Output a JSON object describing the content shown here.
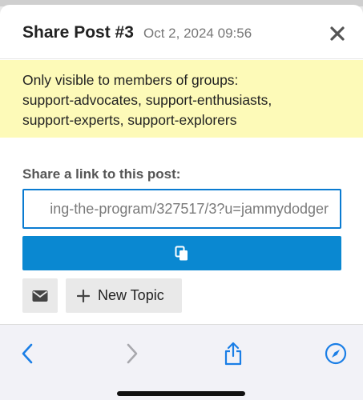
{
  "modal": {
    "title": "Share Post #3",
    "date": "Oct 2, 2024 09:56",
    "notice_lines": [
      "Only visible to members of groups:",
      "support-advocates, support-enthusiasts,",
      "support-experts, support-explorers"
    ],
    "share_label": "Share a link to this post:",
    "link_value": "ing-the-program/327517/3?u=jammydodger",
    "new_topic_label": "New Topic"
  },
  "icons": {
    "close": "close-icon",
    "copy": "copy-icon",
    "mail": "mail-icon",
    "plus": "plus-icon",
    "back": "chevron-left-icon",
    "forward": "chevron-right-icon",
    "share": "share-icon",
    "compass": "compass-icon"
  },
  "colors": {
    "accent": "#0a88d1",
    "notice_bg": "#fdfab8",
    "toolbar_tint": "#1a7ee6"
  }
}
